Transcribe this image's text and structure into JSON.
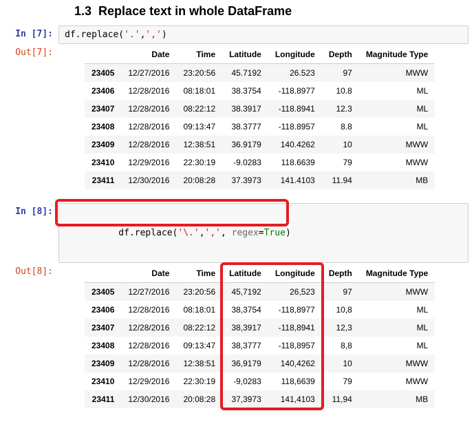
{
  "section": {
    "number": "1.3",
    "title": "Replace text in whole DataFrame"
  },
  "cell7": {
    "in_prompt": "In [7]:",
    "out_prompt": "Out[7]:",
    "code_prefix": "df.replace(",
    "code_arg1": "'.'",
    "code_sep": ",",
    "code_arg2": "','",
    "code_suffix": ")"
  },
  "cell8": {
    "in_prompt": "In [8]:",
    "out_prompt": "Out[8]:",
    "code_prefix": "df.replace(",
    "code_arg1": "'\\.'",
    "code_sep": ",",
    "code_arg2": "','",
    "code_kwarg_name": "regex",
    "code_kwarg_eq": "=",
    "code_kwarg_val": "True",
    "code_suffix": ")"
  },
  "columns": [
    "Date",
    "Time",
    "Latitude",
    "Longitude",
    "Depth",
    "Magnitude Type"
  ],
  "table7": {
    "index": [
      "23405",
      "23406",
      "23407",
      "23408",
      "23409",
      "23410",
      "23411"
    ],
    "rows": [
      [
        "12/27/2016",
        "23:20:56",
        "45.7192",
        "26.523",
        "97",
        "MWW"
      ],
      [
        "12/28/2016",
        "08:18:01",
        "38.3754",
        "-118.8977",
        "10.8",
        "ML"
      ],
      [
        "12/28/2016",
        "08:22:12",
        "38.3917",
        "-118.8941",
        "12.3",
        "ML"
      ],
      [
        "12/28/2016",
        "09:13:47",
        "38.3777",
        "-118.8957",
        "8.8",
        "ML"
      ],
      [
        "12/28/2016",
        "12:38:51",
        "36.9179",
        "140.4262",
        "10",
        "MWW"
      ],
      [
        "12/29/2016",
        "22:30:19",
        "-9.0283",
        "118.6639",
        "79",
        "MWW"
      ],
      [
        "12/30/2016",
        "20:08:28",
        "37.3973",
        "141.4103",
        "11.94",
        "MB"
      ]
    ]
  },
  "table8": {
    "index": [
      "23405",
      "23406",
      "23407",
      "23408",
      "23409",
      "23410",
      "23411"
    ],
    "rows": [
      [
        "12/27/2016",
        "23:20:56",
        "45,7192",
        "26,523",
        "97",
        "MWW"
      ],
      [
        "12/28/2016",
        "08:18:01",
        "38,3754",
        "-118,8977",
        "10,8",
        "ML"
      ],
      [
        "12/28/2016",
        "08:22:12",
        "38,3917",
        "-118,8941",
        "12,3",
        "ML"
      ],
      [
        "12/28/2016",
        "09:13:47",
        "38,3777",
        "-118,8957",
        "8,8",
        "ML"
      ],
      [
        "12/28/2016",
        "12:38:51",
        "36,9179",
        "140,4262",
        "10",
        "MWW"
      ],
      [
        "12/29/2016",
        "22:30:19",
        "-9,0283",
        "118,6639",
        "79",
        "MWW"
      ],
      [
        "12/30/2016",
        "20:08:28",
        "37,3973",
        "141,4103",
        "11,94",
        "MB"
      ]
    ]
  }
}
